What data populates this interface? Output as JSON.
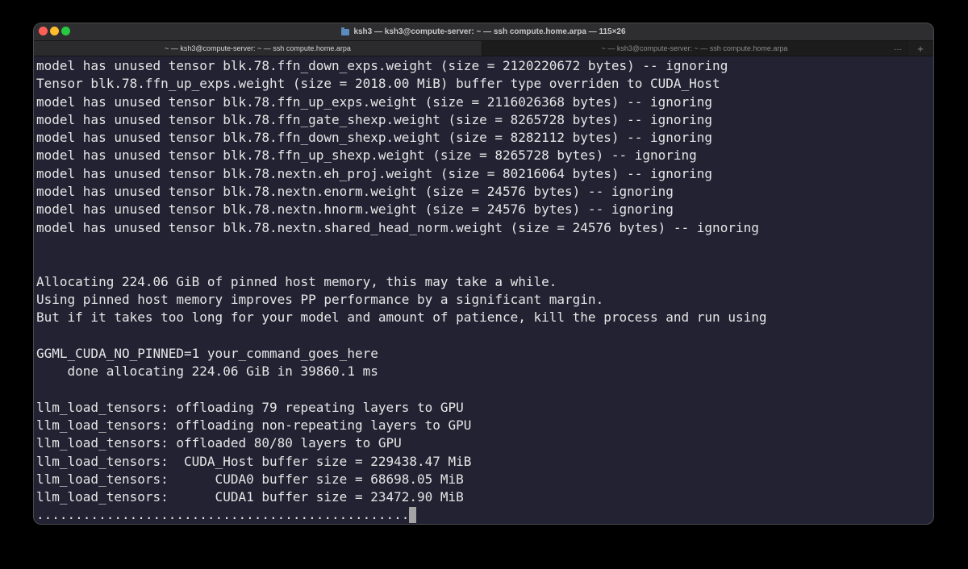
{
  "window": {
    "title": "ksh3 — ksh3@compute-server: ~ — ssh compute.home.arpa — 115×26"
  },
  "tabs": [
    {
      "label": "~ — ksh3@compute-server: ~ — ssh compute.home.arpa",
      "active": true
    },
    {
      "label": "~ — ksh3@compute-server: ~ — ssh compute.home.arpa",
      "active": false
    }
  ],
  "tab_overflow": "…",
  "tab_add": "+",
  "terminal": {
    "lines": [
      "model has unused tensor blk.78.ffn_down_exps.weight (size = 2120220672 bytes) -- ignoring",
      "Tensor blk.78.ffn_up_exps.weight (size = 2018.00 MiB) buffer type overriden to CUDA_Host",
      "model has unused tensor blk.78.ffn_up_exps.weight (size = 2116026368 bytes) -- ignoring",
      "model has unused tensor blk.78.ffn_gate_shexp.weight (size = 8265728 bytes) -- ignoring",
      "model has unused tensor blk.78.ffn_down_shexp.weight (size = 8282112 bytes) -- ignoring",
      "model has unused tensor blk.78.ffn_up_shexp.weight (size = 8265728 bytes) -- ignoring",
      "model has unused tensor blk.78.nextn.eh_proj.weight (size = 80216064 bytes) -- ignoring",
      "model has unused tensor blk.78.nextn.enorm.weight (size = 24576 bytes) -- ignoring",
      "model has unused tensor blk.78.nextn.hnorm.weight (size = 24576 bytes) -- ignoring",
      "model has unused tensor blk.78.nextn.shared_head_norm.weight (size = 24576 bytes) -- ignoring",
      "",
      "",
      "Allocating 224.06 GiB of pinned host memory, this may take a while.",
      "Using pinned host memory improves PP performance by a significant margin.",
      "But if it takes too long for your model and amount of patience, kill the process and run using",
      "",
      "GGML_CUDA_NO_PINNED=1 your_command_goes_here",
      "    done allocating 224.06 GiB in 39860.1 ms",
      "",
      "llm_load_tensors: offloading 79 repeating layers to GPU",
      "llm_load_tensors: offloading non-repeating layers to GPU",
      "llm_load_tensors: offloaded 80/80 layers to GPU",
      "llm_load_tensors:  CUDA_Host buffer size = 229438.47 MiB",
      "llm_load_tensors:      CUDA0 buffer size = 68698.05 MiB",
      "llm_load_tensors:      CUDA1 buffer size = 23472.90 MiB",
      "................................................"
    ]
  }
}
